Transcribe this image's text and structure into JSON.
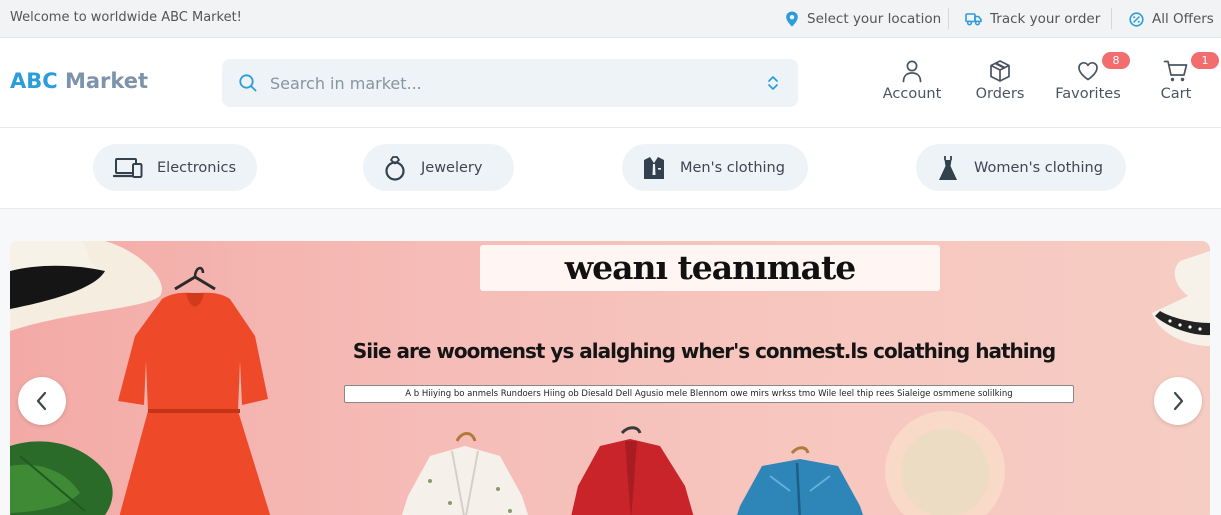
{
  "topbar": {
    "welcome": "Welcome to worldwide ABC Market!",
    "location_label": "Select your location",
    "track_label": "Track your order",
    "offers_label": "All Offers"
  },
  "header": {
    "logo_primary": "ABC",
    "logo_secondary": "Market",
    "search_placeholder": "Search in market...",
    "account_label": "Account",
    "orders_label": "Orders",
    "favorites_label": "Favorites",
    "favorites_count": "8",
    "cart_label": "Cart",
    "cart_count": "1"
  },
  "categories": [
    {
      "label": "Electronics",
      "icon": "devices-icon"
    },
    {
      "label": "Jewelery",
      "icon": "ring-icon"
    },
    {
      "label": "Men's clothing",
      "icon": "suit-icon"
    },
    {
      "label": "Women's clothing",
      "icon": "dress-icon"
    }
  ],
  "banner": {
    "title": "weanı teanımate",
    "subtitle": "Siie are woomenst ys alalghing wher's conmest.ls colathing hathing",
    "small_text": "A b Hiiying bo anmels Rundoers Hiing ob Diesald Dell Agusio mele Blennom owe mirs wrkss tmo Wile leel thip rees Sialeige osmmene solilking"
  },
  "colors": {
    "brand_blue": "#2d9cdb",
    "brand_gray": "#7c94ab",
    "badge_red": "#f26d6d",
    "chip_bg": "#eef3f7"
  }
}
